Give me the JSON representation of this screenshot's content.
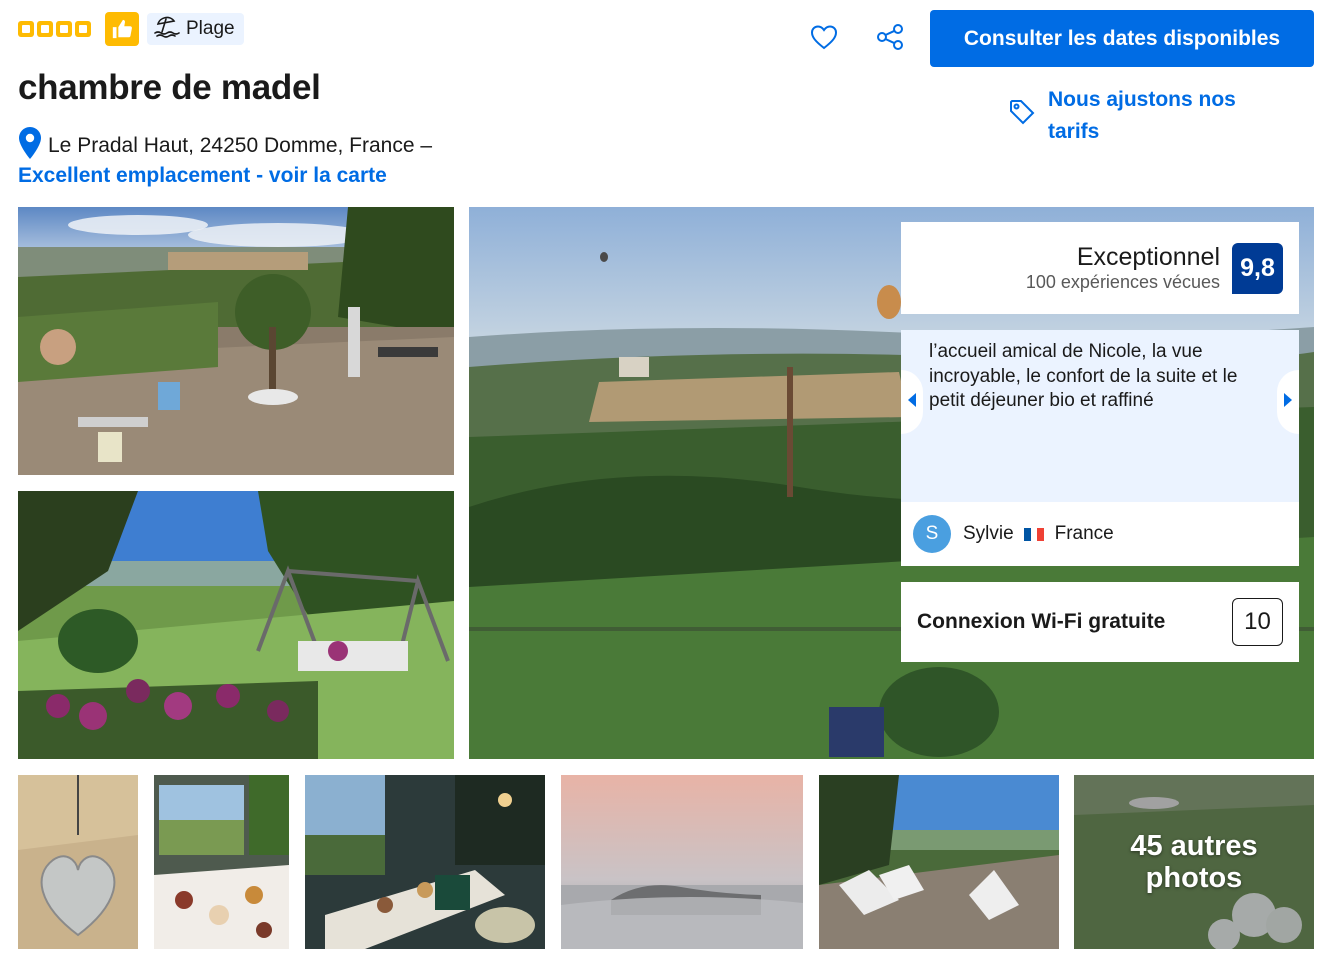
{
  "header": {
    "star_rating": 4,
    "badge_icon": "thumbs-up-icon",
    "tag_label": "Plage",
    "tag_icon": "beach-umbrella-icon",
    "title": "chambre de madel",
    "address": "Le Pradal Haut, 24250 Domme, France –",
    "map_link": "Excellent emplacement - voir la carte",
    "icons": [
      "heart-icon",
      "share-icon"
    ],
    "cta_label": "Consulter les dates disponibles",
    "price_match_label": "Nous ajustons nos tarifs",
    "price_match_icon": "price-tag-icon"
  },
  "review": {
    "rating_word": "Exceptionnel",
    "count_text": "100 expériences vécues",
    "score": "9,8",
    "quote": "l’accueil amical de Nicole, la vue incroyable, le confort de la suite et le petit déjeuner bio et raffiné",
    "reviewer_initial": "S",
    "reviewer_name": "Sylvie",
    "reviewer_country": "France",
    "wifi_label": "Connexion Wi-Fi gratuite",
    "wifi_score": "10"
  },
  "gallery": {
    "more_photos_label": "45 autres photos"
  },
  "colors": {
    "brand_blue": "#006ce4",
    "score_navy": "#003b95",
    "accent_yellow": "#febb02",
    "quote_bg": "#ebf3ff"
  }
}
